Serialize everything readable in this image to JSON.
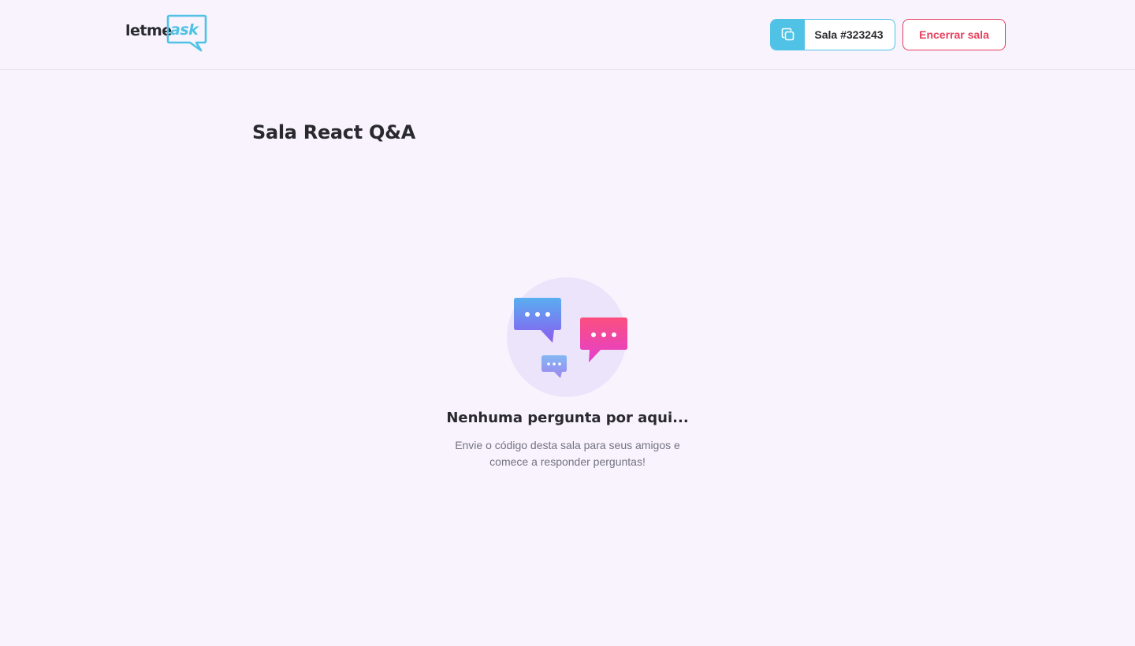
{
  "header": {
    "logo": {
      "text_primary": "letme",
      "text_accent": "ask",
      "accent_color": "#4fc2e5"
    },
    "room_code": {
      "icon": "copy-icon",
      "label": "Sala #323243"
    },
    "close_button": {
      "label": "Encerrar sala",
      "color": "#e73f5d"
    }
  },
  "main": {
    "title": "Sala React Q&A",
    "empty_state": {
      "icon": "chat-bubbles-icon",
      "title": "Nenhuma pergunta por aqui...",
      "description_line1": "Envie o código desta sala para seus amigos e",
      "description_line2": "comece a responder perguntas!"
    }
  }
}
